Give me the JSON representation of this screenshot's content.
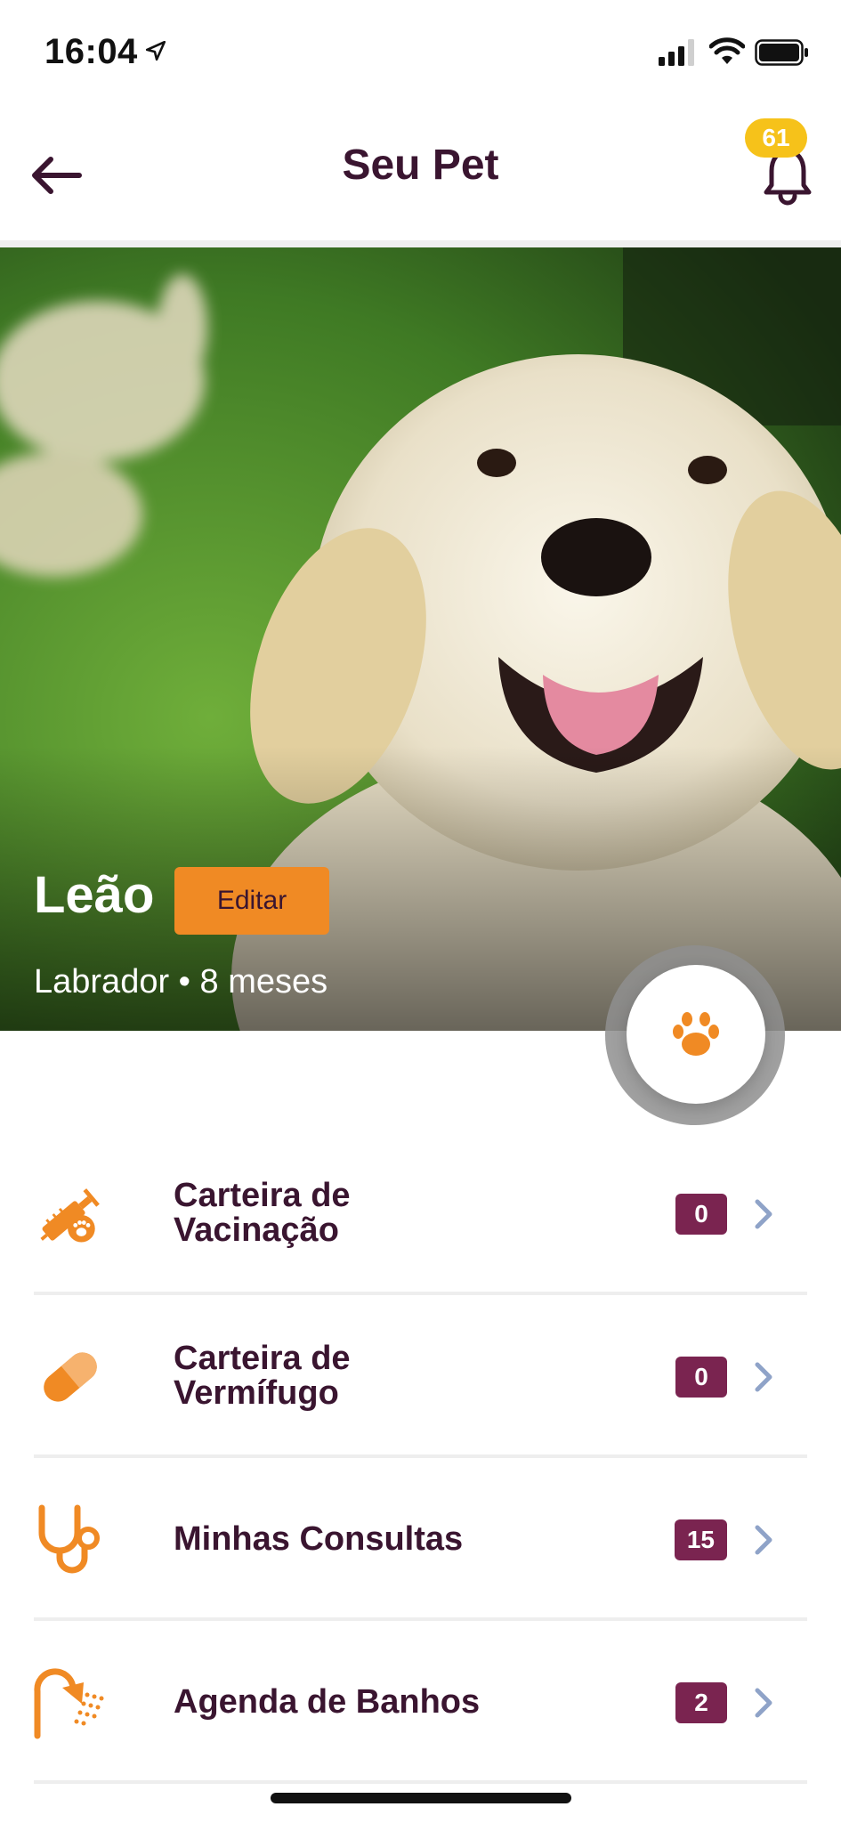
{
  "status_bar": {
    "time": "16:04",
    "icons": [
      "location-arrow-icon",
      "signal-icon",
      "wifi-icon",
      "battery-icon"
    ]
  },
  "nav": {
    "title": "Seu Pet",
    "back_icon": "arrow-left-icon",
    "bell_icon": "bell-icon",
    "notification_count": "61"
  },
  "pet": {
    "name": "Leão",
    "edit_label": "Editar",
    "meta": "Labrador • 8 meses"
  },
  "fab": {
    "icon": "paw-icon"
  },
  "menu": {
    "items": [
      {
        "label_line1": "Carteira de",
        "label_line2": "Vacinação",
        "count": "0",
        "icon": "syringe-paw-icon"
      },
      {
        "label_line1": "Carteira de",
        "label_line2": "Vermífugo",
        "count": "0",
        "icon": "pill-icon"
      },
      {
        "label_line1": "Minhas Consultas",
        "label_line2": "",
        "count": "15",
        "icon": "stethoscope-icon"
      },
      {
        "label_line1": "Agenda de Banhos",
        "label_line2": "",
        "count": "2",
        "icon": "shower-icon"
      }
    ]
  },
  "colors": {
    "accent_orange": "#f08a24",
    "text_plum": "#3a1530",
    "badge_plum": "#7a2450",
    "notif_yellow": "#f6c21a",
    "chevron_blue": "#8fa3c8"
  }
}
